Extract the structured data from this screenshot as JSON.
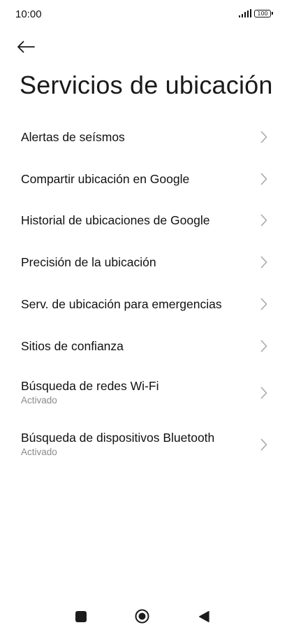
{
  "status_bar": {
    "time": "10:00",
    "battery": "100"
  },
  "header": {
    "back_icon": "arrow-left-icon",
    "title": "Servicios de ubicación"
  },
  "items": [
    {
      "label": "Alertas de seísmos"
    },
    {
      "label": "Compartir ubicación en Google"
    },
    {
      "label": "Historial de ubicaciones de Google"
    },
    {
      "label": "Precisión de la ubicación"
    },
    {
      "label": "Serv. de ubicación para emergencias"
    },
    {
      "label": "Sitios de confianza"
    },
    {
      "label": "Búsqueda de redes Wi-Fi",
      "subtitle": "Activado"
    },
    {
      "label": "Búsqueda de dispositivos Bluetooth",
      "subtitle": "Activado"
    }
  ],
  "nav_bar": {
    "recents_icon": "square-icon",
    "home_icon": "circle-icon",
    "back_icon": "triangle-back-icon"
  },
  "colors": {
    "background": "#ffffff",
    "text": "#111111",
    "subtext": "#8a8a8a",
    "chevron": "#a8a8a8"
  }
}
